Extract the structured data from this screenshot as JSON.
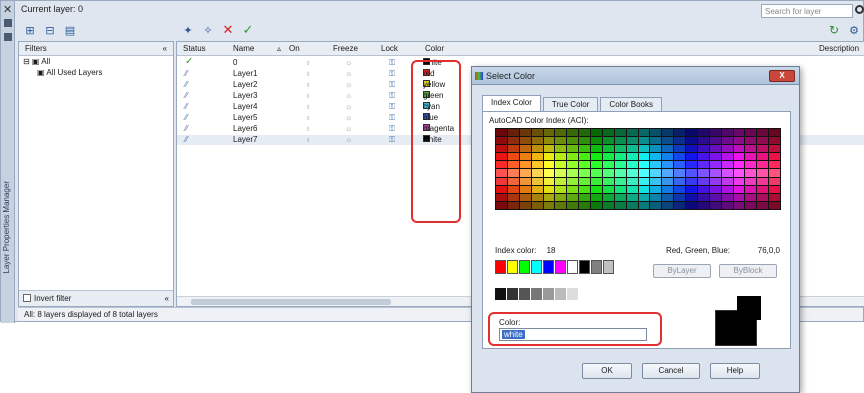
{
  "palette_title": "Layer Properties Manager",
  "current_layer": "Current layer: 0",
  "search_placeholder": "Search for layer",
  "tree": {
    "header": "Filters",
    "items": [
      "All",
      "All Used Layers"
    ],
    "invert_label": "Invert filter"
  },
  "columns": [
    "Status",
    "Name",
    "On",
    "Freeze",
    "Lock",
    "Color",
    "Description"
  ],
  "layers": [
    {
      "name": "0",
      "status": "current",
      "color_name": "white",
      "color_hex": "#000000"
    },
    {
      "name": "Layer1",
      "status": "layer",
      "color_name": "red",
      "color_hex": "#e02020"
    },
    {
      "name": "Layer2",
      "status": "layer",
      "color_name": "yellow",
      "color_hex": "#d8d020"
    },
    {
      "name": "Layer3",
      "status": "layer",
      "color_name": "green",
      "color_hex": "#50a030"
    },
    {
      "name": "Layer4",
      "status": "layer",
      "color_name": "cyan",
      "color_hex": "#40b0c8"
    },
    {
      "name": "Layer5",
      "status": "layer",
      "color_name": "blue",
      "color_hex": "#3050c0"
    },
    {
      "name": "Layer6",
      "status": "layer",
      "color_name": "magenta",
      "color_hex": "#a040a0"
    },
    {
      "name": "Layer7",
      "status": "layer",
      "color_name": "white",
      "color_hex": "#000000"
    }
  ],
  "statusbar": "All: 8 layers displayed of 8 total layers",
  "dialog": {
    "title": "Select Color",
    "tabs": [
      "Index Color",
      "True Color",
      "Color Books"
    ],
    "aci_label": "AutoCAD Color Index (ACI):",
    "index_label": "Index color:",
    "index_value": "18",
    "rgb_label": "Red, Green, Blue:",
    "rgb_value": "76,0,0",
    "bylayer": "ByLayer",
    "byblock": "ByBlock",
    "color_label": "Color:",
    "color_value": "white",
    "ok": "OK",
    "cancel": "Cancel",
    "help": "Help",
    "close": "X"
  },
  "colors": {
    "highlight": "#e03030"
  }
}
